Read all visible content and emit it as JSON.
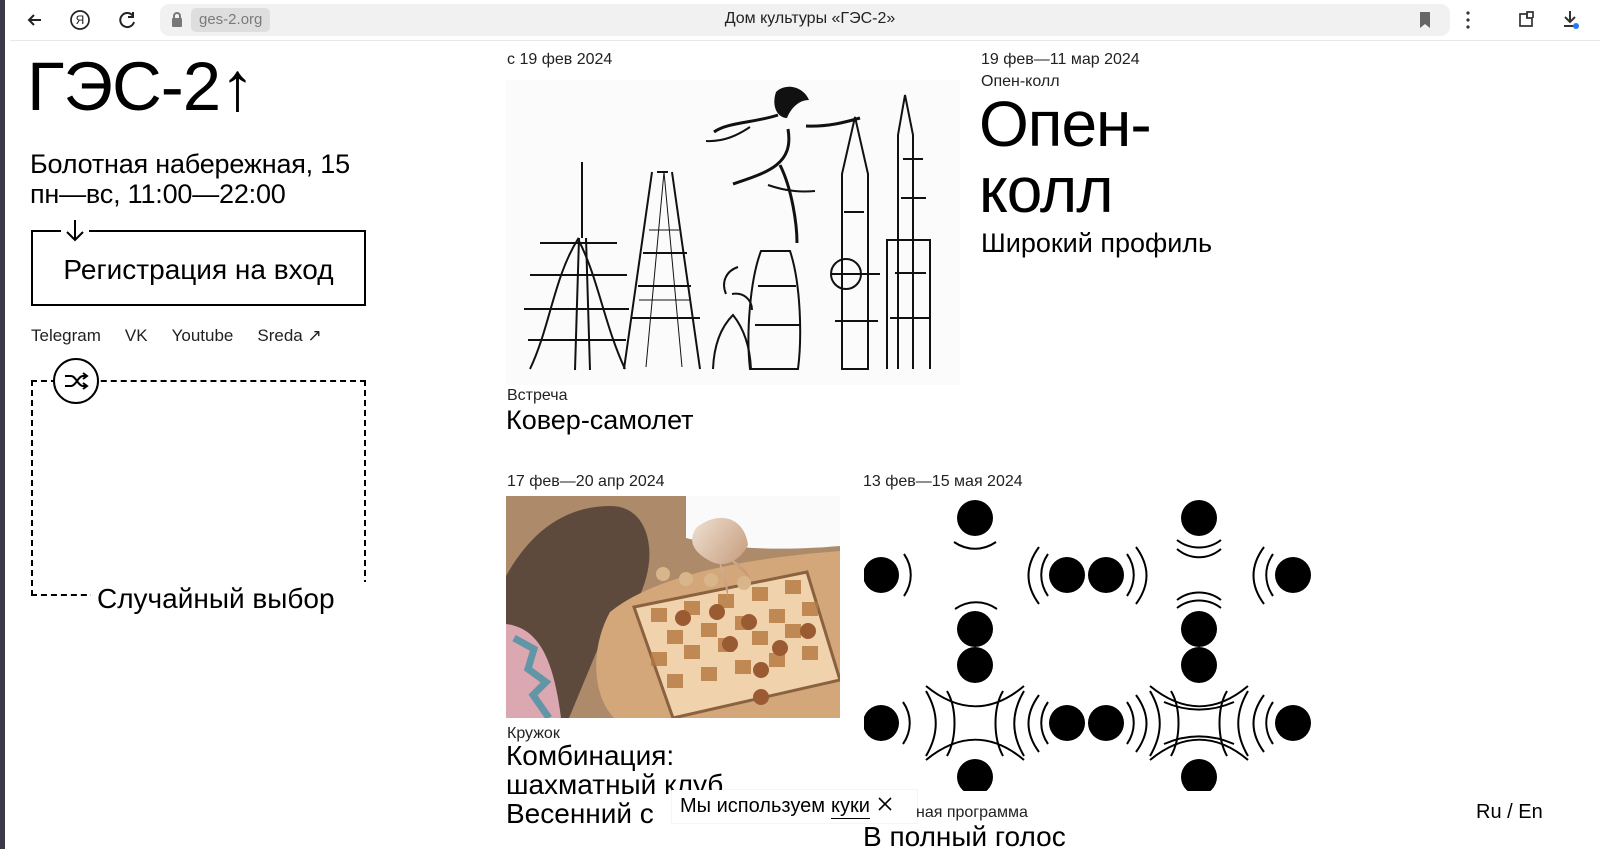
{
  "browser": {
    "domain": "ges-2.org",
    "title": "Дом культуры «ГЭС-2»"
  },
  "site": {
    "logo": "ГЭС-2↑",
    "address_line1": "Болотная набережная, 15",
    "address_line2": "пн—вс, 11:00—22:00",
    "registration": "Регистрация на вход",
    "social": [
      "Telegram",
      "VK",
      "Youtube",
      "Sreda ↗"
    ],
    "random": "Случайный выбор",
    "events": [
      {
        "date": "с 19 фев 2024",
        "kind": "Встреча",
        "title": "Ковер-самолет"
      },
      {
        "date": "19 фев—11 мар 2024",
        "kind": "Опен-колл",
        "title_line1": "Опен-",
        "title_line2": "колл",
        "subtitle": "Широкий профиль"
      },
      {
        "date": "17 фев—20 апр 2024",
        "kind": "Кружок",
        "title_line1": "Комбинация:",
        "title_line2": "шахматный клуб",
        "title_line3": "Весенний с"
      },
      {
        "date": "13 фев—15 мая 2024",
        "kind": "ная программа",
        "title": "В полный голос"
      }
    ],
    "cookie": "Мы используем",
    "cookie_link": "куки",
    "lang": "Ru / En"
  },
  "colors": {
    "text": "#000000",
    "background": "#ffffff",
    "browser_chip": "#dedede"
  },
  "icons": [
    "back-icon",
    "yandex-icon",
    "reload-icon",
    "lock-icon",
    "bookmark-icon",
    "more-icon",
    "extensions-icon",
    "download-icon",
    "shuffle-icon",
    "close-icon"
  ]
}
